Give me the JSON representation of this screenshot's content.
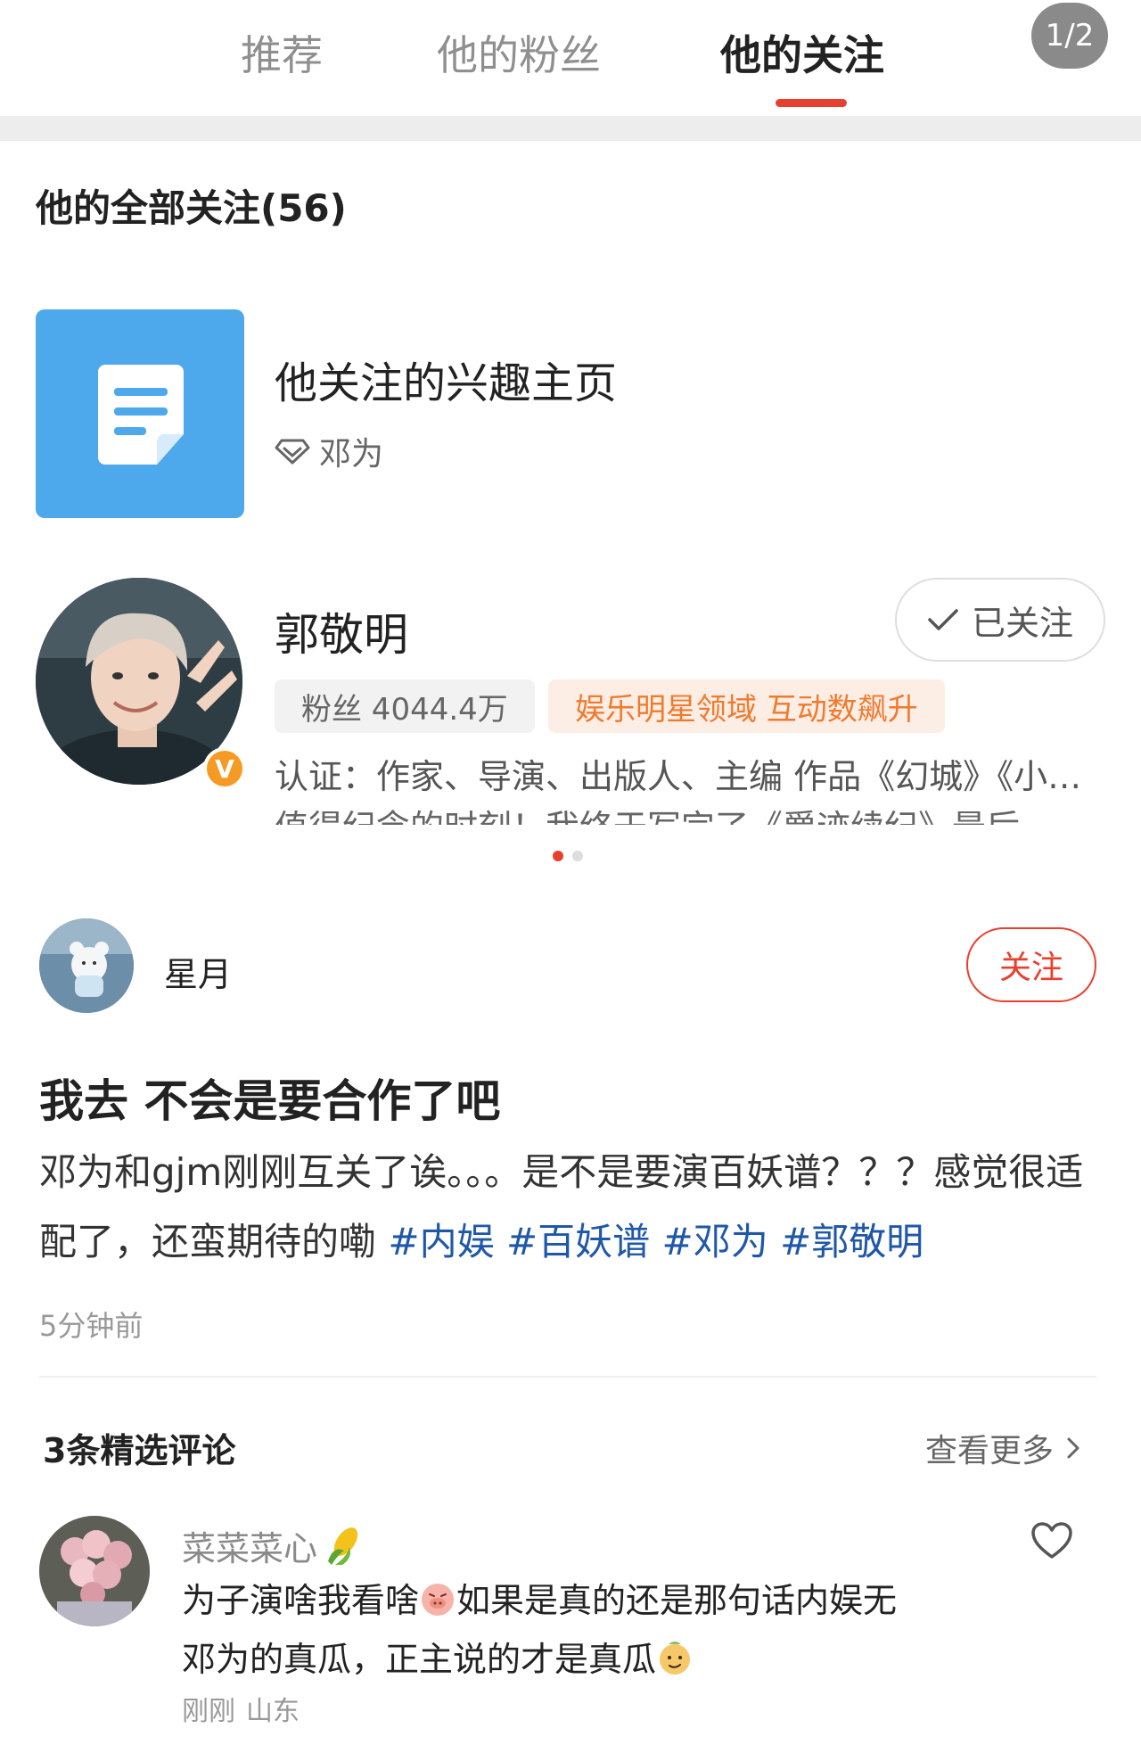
{
  "tabs": [
    {
      "label": "推荐",
      "active": false
    },
    {
      "label": "他的粉丝",
      "active": false
    },
    {
      "label": "他的关注",
      "active": true
    }
  ],
  "page_indicator": "1/2",
  "section_title": "他的全部关注(56)",
  "interest_page": {
    "title": "他关注的兴趣主页",
    "owner": "邓为",
    "icon": "document-icon"
  },
  "followed_user": {
    "name": "郭敬明",
    "follow_state": "已关注",
    "fans_label": "粉丝 4044.4万",
    "domain_tag": "娱乐明星领域 互动数飙升",
    "cert": "认证：作家、导演、出版人、主编 作品《幻城》《小…",
    "next_line_partial": "值得纪念的时刻！我终于写完了《爵迹续纪》最后"
  },
  "carousel": {
    "count": 2,
    "active_index": 0
  },
  "post": {
    "author": "星月",
    "follow_label": "关注",
    "title": "我去 不会是要合作了吧",
    "body": "邓为和gjm刚刚互关了诶。。。是不是要演百妖谱？？？感觉很适配了，还蛮期待的嘞",
    "hashtags": [
      "#内娱",
      "#百妖谱",
      "#邓为",
      "#郭敬明"
    ],
    "time": "5分钟前"
  },
  "comments": {
    "title": "3条精选评论",
    "view_more": "查看更多",
    "items": [
      {
        "user": "菜菜菜心",
        "user_emoji": "corn-icon",
        "text_part1": "为子演啥我看啥",
        "text_part2": "如果是真的还是那句话内娱无邓为的真瓜，正主说的才是真瓜",
        "time": "刚刚",
        "location": "山东"
      }
    ]
  },
  "colors": {
    "accent": "#e8402f",
    "hashtag": "#1f58a8",
    "interest_tile": "#4ea8ec",
    "tag_orange": "#f07a2e"
  }
}
